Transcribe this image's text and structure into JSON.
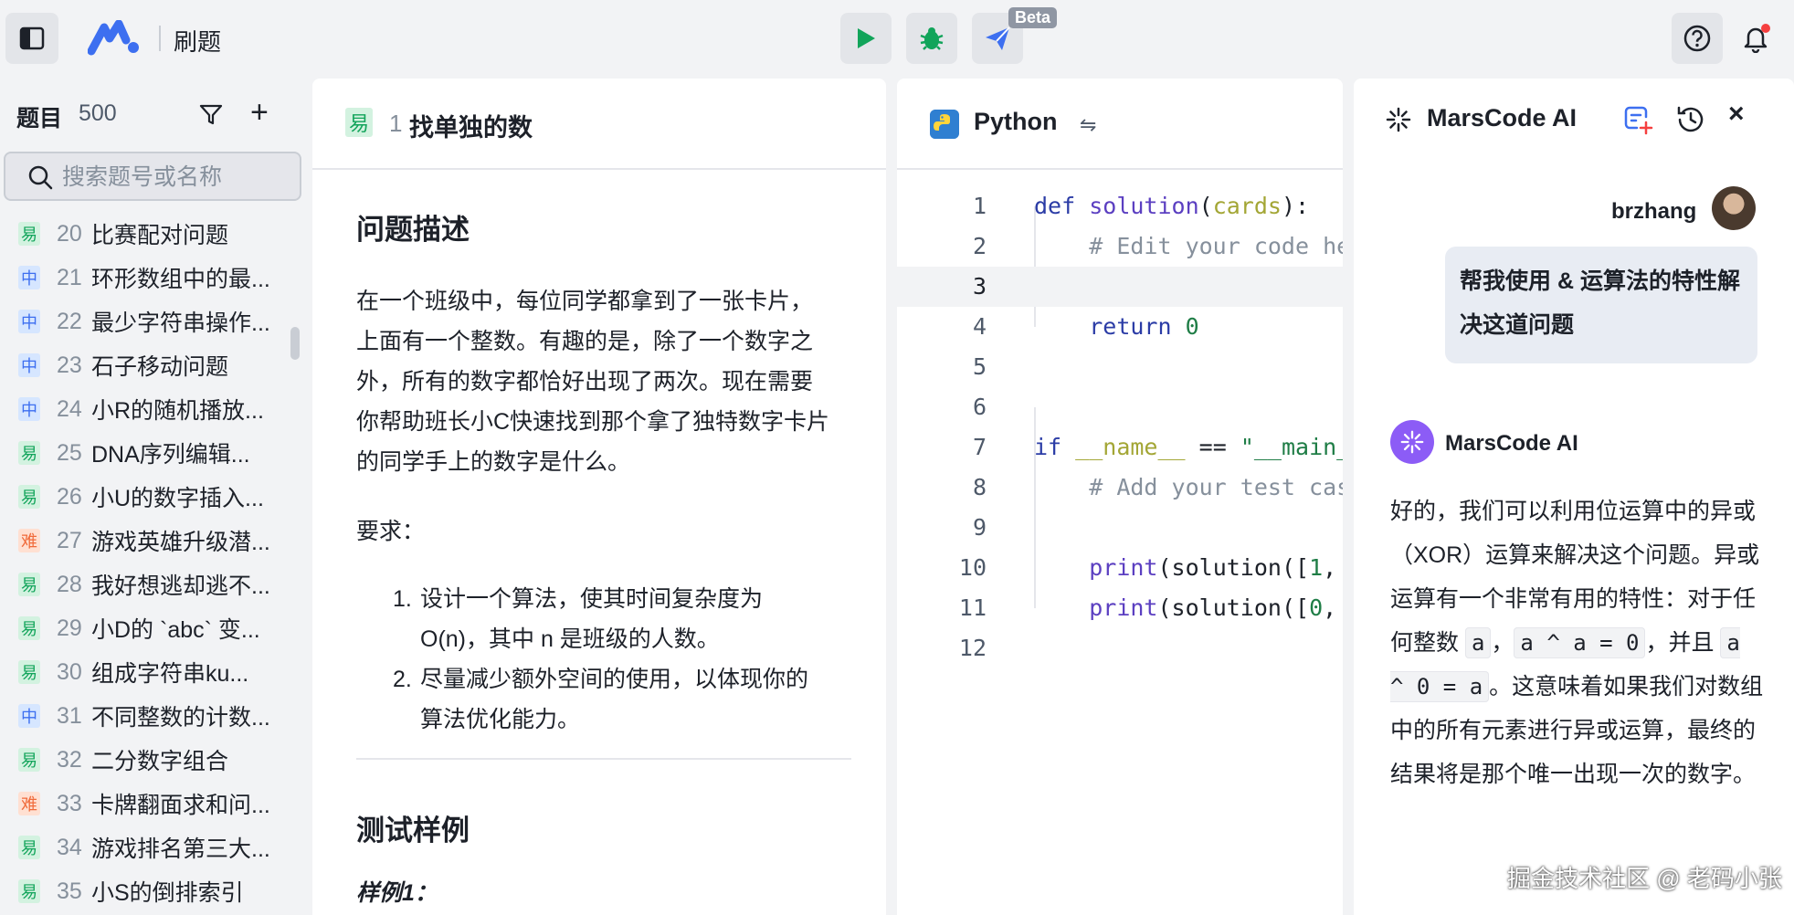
{
  "app": {
    "title": "刷题",
    "beta_label": "Beta"
  },
  "sidebar": {
    "heading": "题目",
    "count": "500",
    "search_placeholder": "搜索题号或名称",
    "items": [
      {
        "badge": "易",
        "level": "easy",
        "num": "20",
        "title": "比赛配对问题"
      },
      {
        "badge": "中",
        "level": "medium",
        "num": "21",
        "title": "环形数组中的最..."
      },
      {
        "badge": "中",
        "level": "medium",
        "num": "22",
        "title": "最少字符串操作..."
      },
      {
        "badge": "中",
        "level": "medium",
        "num": "23",
        "title": "石子移动问题"
      },
      {
        "badge": "中",
        "level": "medium",
        "num": "24",
        "title": "小R的随机播放..."
      },
      {
        "badge": "易",
        "level": "easy",
        "num": "25",
        "title": "DNA序列编辑..."
      },
      {
        "badge": "易",
        "level": "easy",
        "num": "26",
        "title": "小U的数字插入..."
      },
      {
        "badge": "难",
        "level": "hard",
        "num": "27",
        "title": "游戏英雄升级潜..."
      },
      {
        "badge": "易",
        "level": "easy",
        "num": "28",
        "title": "我好想逃却逃不..."
      },
      {
        "badge": "易",
        "level": "easy",
        "num": "29",
        "title": "小D的 `abc` 变..."
      },
      {
        "badge": "易",
        "level": "easy",
        "num": "30",
        "title": "组成字符串ku..."
      },
      {
        "badge": "中",
        "level": "medium",
        "num": "31",
        "title": "不同整数的计数..."
      },
      {
        "badge": "易",
        "level": "easy",
        "num": "32",
        "title": "二分数字组合"
      },
      {
        "badge": "难",
        "level": "hard",
        "num": "33",
        "title": "卡牌翻面求和问..."
      },
      {
        "badge": "易",
        "level": "easy",
        "num": "34",
        "title": "游戏排名第三大..."
      },
      {
        "badge": "易",
        "level": "easy",
        "num": "35",
        "title": "小S的倒排索引"
      }
    ]
  },
  "problem": {
    "badge": "易",
    "num": "1",
    "title": "找单独的数",
    "section_desc": "问题描述",
    "desc_lines": [
      "在一个班级中，每位同学都拿到了一张卡片，",
      "上面有一个整数。有趣的是，除了一个数字之",
      "外，所有的数字都恰好出现了两次。现在需要",
      "你帮助班长小C快速找到那个拿了独特数字卡片",
      "的同学手上的数字是什么。"
    ],
    "requirements_label": "要求：",
    "requirements": [
      {
        "n": "1.",
        "lines": [
          "设计一个算法，使其时间复杂度为",
          "O(n)，其中 n 是班级的人数。"
        ]
      },
      {
        "n": "2.",
        "lines": [
          "尽量减少额外空间的使用，以体现你的",
          "算法优化能力。"
        ]
      }
    ],
    "section_tests": "测试样例",
    "example_label": "样例1："
  },
  "editor": {
    "language": "Python",
    "swap_symbol": "⇋",
    "line_numbers": [
      "1",
      "2",
      "3",
      "4",
      "5",
      "6",
      "7",
      "8",
      "9",
      "10",
      "11",
      "12"
    ]
  },
  "ai": {
    "title": "MarsCode AI",
    "user_name": "brzhang",
    "user_message": "帮我使用 & 运算法的特性解决这道问题",
    "bot_name": "MarsCode AI",
    "bot_text_1": "好的，我们可以利用位运算中的异或（XOR）运算来解决这个问题。异或运算有一个非常有用的特性：对于任何整数 ",
    "code_a": "a",
    "sep_1": "，",
    "code_a_xor_a": "a ^ a = 0",
    "sep_2": "，并且 ",
    "code_a_xor_0": "a ^ 0 = a",
    "bot_text_2": "。这意味着如果我们对数组中的所有元素进行异或运算，最终的结果将是那个唯一出现一次的数字。"
  },
  "watermark": "掘金技术社区 @ 老码小张"
}
